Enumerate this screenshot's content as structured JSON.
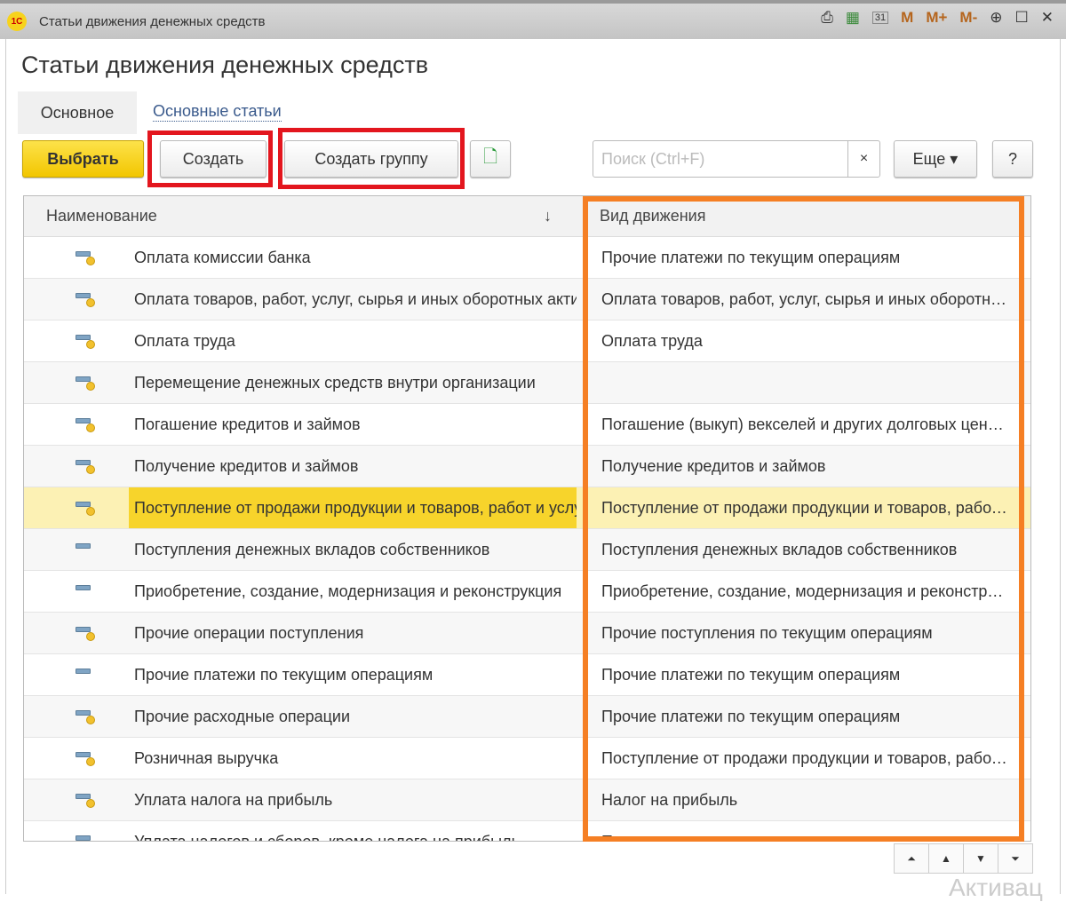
{
  "window": {
    "title": "Статьи движения денежных средств",
    "icons": [
      "print-icon",
      "calculator-icon",
      "calendar-icon",
      "memory-m",
      "memory-plus",
      "memory-minus",
      "zoom-icon",
      "maximize-icon",
      "close-icon"
    ],
    "m": "M",
    "mplus": "M+",
    "mminus": "M-",
    "calendar": "31"
  },
  "page_title": "Статьи движения денежных средств",
  "tabs": [
    {
      "label": "Основное",
      "active": true
    },
    {
      "label": "Основные статьи",
      "active": false
    }
  ],
  "toolbar": {
    "select": "Выбрать",
    "create": "Создать",
    "create_group": "Создать группу",
    "search_placeholder": "Поиск (Ctrl+F)",
    "search_value": "",
    "clear": "×",
    "more": "Еще ▾",
    "help": "?"
  },
  "table": {
    "columns": [
      "Наименование",
      "Вид движения"
    ],
    "sort_indicator": "↓",
    "rows": [
      {
        "name": "Оплата комиссии банка",
        "kind": "Прочие платежи по текущим операциям",
        "dot": true
      },
      {
        "name": "Оплата товаров, работ, услуг, сырья и иных оборотных активов",
        "kind": "Оплата товаров, работ, услуг, сырья и иных оборотных активов",
        "dot": true
      },
      {
        "name": "Оплата труда",
        "kind": "Оплата труда",
        "dot": true
      },
      {
        "name": "Перемещение денежных средств внутри организации",
        "kind": "",
        "dot": true
      },
      {
        "name": "Погашение кредитов и займов",
        "kind": "Погашение (выкуп) векселей и других долговых ценных бумаг",
        "dot": true
      },
      {
        "name": "Получение кредитов и займов",
        "kind": "Получение кредитов и займов",
        "dot": true
      },
      {
        "name": "Поступление от продажи продукции и товаров, работ и услуг",
        "kind": "Поступление от продажи продукции и товаров, работ и услуг",
        "dot": true,
        "selected": true
      },
      {
        "name": "Поступления денежных вкладов собственников",
        "kind": "Поступления денежных вкладов собственников",
        "dot": false
      },
      {
        "name": "Приобретение, создание, модернизация и реконструкция",
        "kind": "Приобретение, создание, модернизация и реконструкция",
        "dot": false
      },
      {
        "name": "Прочие операции поступления",
        "kind": "Прочие поступления по текущим операциям",
        "dot": true
      },
      {
        "name": "Прочие платежи по текущим операциям",
        "kind": "Прочие платежи по текущим операциям",
        "dot": false
      },
      {
        "name": "Прочие расходные операции",
        "kind": "Прочие платежи по текущим операциям",
        "dot": true
      },
      {
        "name": "Розничная выручка",
        "kind": "Поступление от продажи продукции и товаров, работ и услуг",
        "dot": true
      },
      {
        "name": "Уплата налога на прибыль",
        "kind": "Налог на прибыль",
        "dot": true
      },
      {
        "name": "Уплата налогов и сборов, кроме налога на прибыль",
        "kind": "П",
        "dot": false
      }
    ]
  },
  "nav": {
    "first": "⏶",
    "up": "▲",
    "down": "▼",
    "last": "⏷"
  },
  "watermark": "Активац",
  "colors": {
    "selected_row": "#fcf1b4",
    "selected_cell": "#f7d42b",
    "primary_button": "#f2c600",
    "annotation_red": "#e3161e",
    "annotation_orange": "#f57f24"
  }
}
